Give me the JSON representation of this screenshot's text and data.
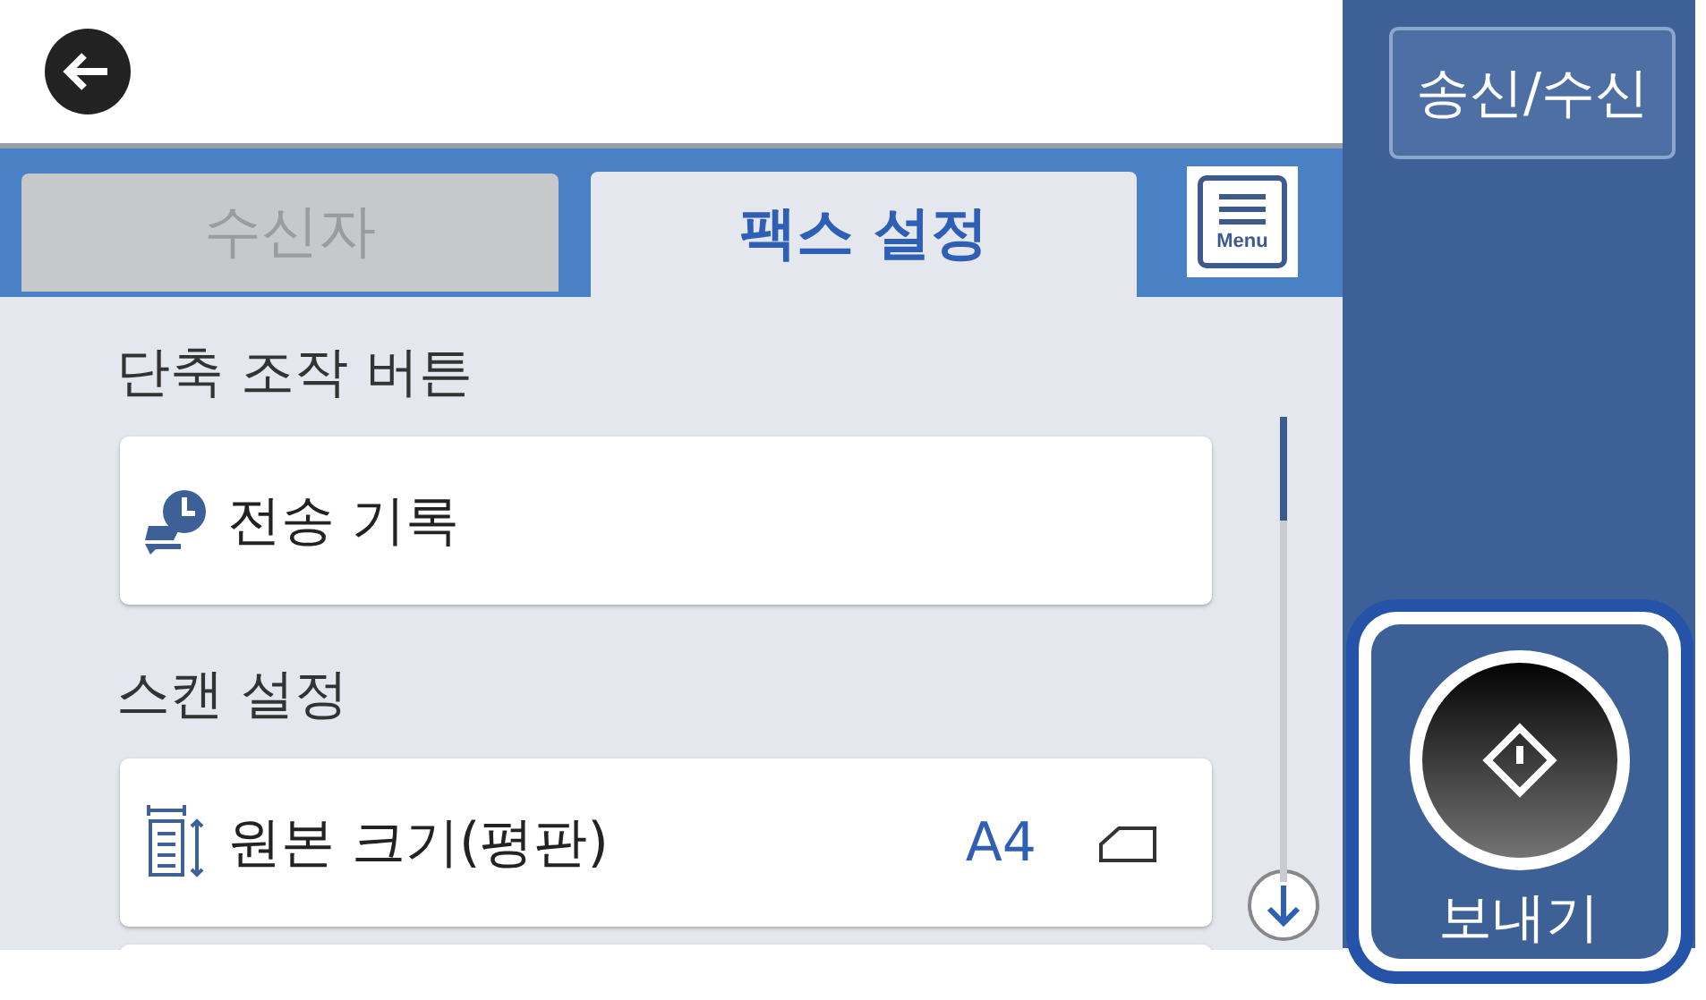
{
  "tabs": [
    {
      "label": "수신자",
      "selected": false
    },
    {
      "label": "팩스 설정",
      "selected": true
    }
  ],
  "menu_button": {
    "label": "Menu"
  },
  "sections": [
    {
      "heading": "단축 조작 버튼",
      "items": [
        {
          "kind": "history",
          "label": "전송 기록"
        }
      ]
    },
    {
      "heading": "스캔 설정",
      "items": [
        {
          "kind": "size",
          "label": "원본 크기(평판)",
          "value": "A4"
        }
      ]
    }
  ],
  "side": {
    "mode_button": "송신/수신",
    "send_button": "보내기"
  }
}
